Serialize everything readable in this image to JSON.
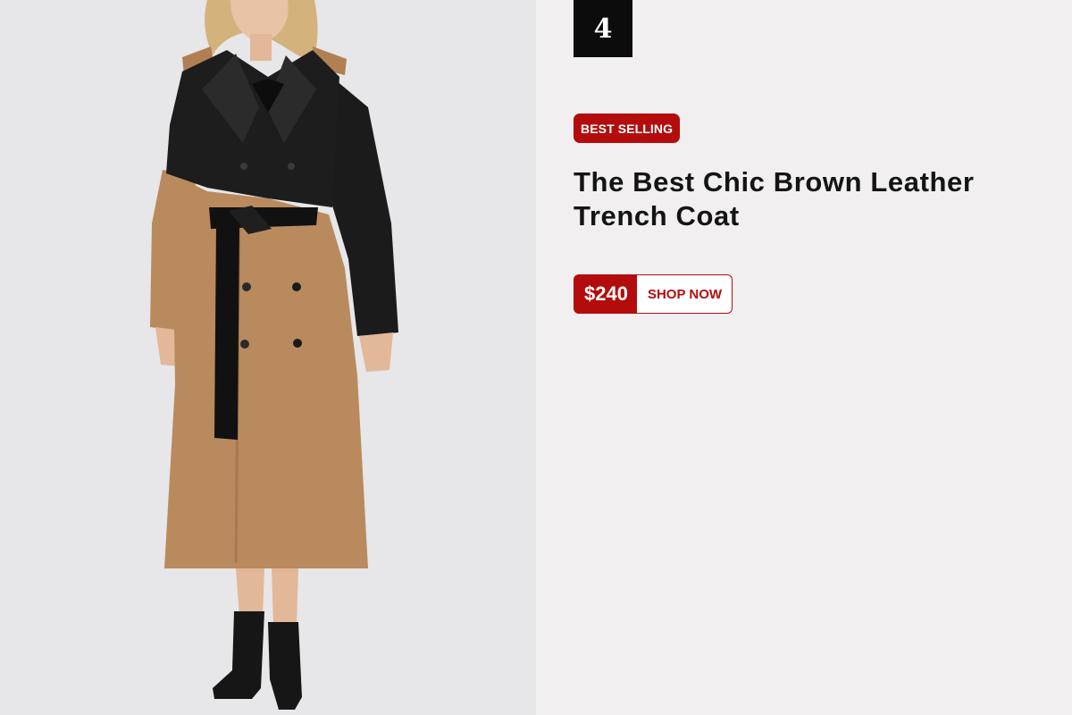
{
  "product": {
    "rank": "4",
    "badge": "BEST SELLING",
    "title": "The Best Chic Brown Leather Trench Coat",
    "price": "$240",
    "cta_label": "SHOP NOW",
    "image_alt": "Woman wearing a black leather and camel brown two-tone trench coat with black belt and ankle boots"
  },
  "colors": {
    "accent": "#b40c0c",
    "rank_background": "#0c0c0c",
    "panel_background": "#f1eff0",
    "photo_background": "#e7e6e8",
    "coat_leather": "#1a1a1a",
    "coat_camel": "#b98a5e"
  }
}
